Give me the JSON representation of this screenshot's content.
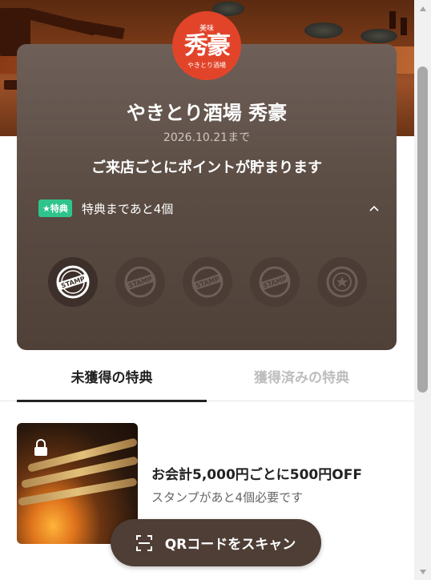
{
  "shop": {
    "logo_text": "秀豪",
    "logo_sub": "やきとり酒場",
    "logo_top": "美味",
    "name": "やきとり酒場 秀豪",
    "expiry": "2026.10.21まで",
    "tagline": "ご来店ごとにポイントが貯まります"
  },
  "bonus": {
    "badge": "★特典",
    "text": "特典まであと4個"
  },
  "stamps": [
    {
      "state": "earned",
      "label": "STAMP"
    },
    {
      "state": "empty",
      "label": "STAMP"
    },
    {
      "state": "empty",
      "label": "STAMP"
    },
    {
      "state": "empty",
      "label": "STAMP"
    },
    {
      "state": "reward",
      "label": ""
    }
  ],
  "tabs": {
    "unearned": "未獲得の特典",
    "earned": "獲得済みの特典"
  },
  "reward": {
    "title": "お会計5,000円ごとに500円OFF",
    "description": "スタンプがあと4個必要です"
  },
  "scan_button": {
    "label": "QRコードをスキャン"
  },
  "colors": {
    "card": "#5e5048",
    "badge": "#2ec48b",
    "logo": "#e2442a",
    "button": "#4e3e36"
  }
}
